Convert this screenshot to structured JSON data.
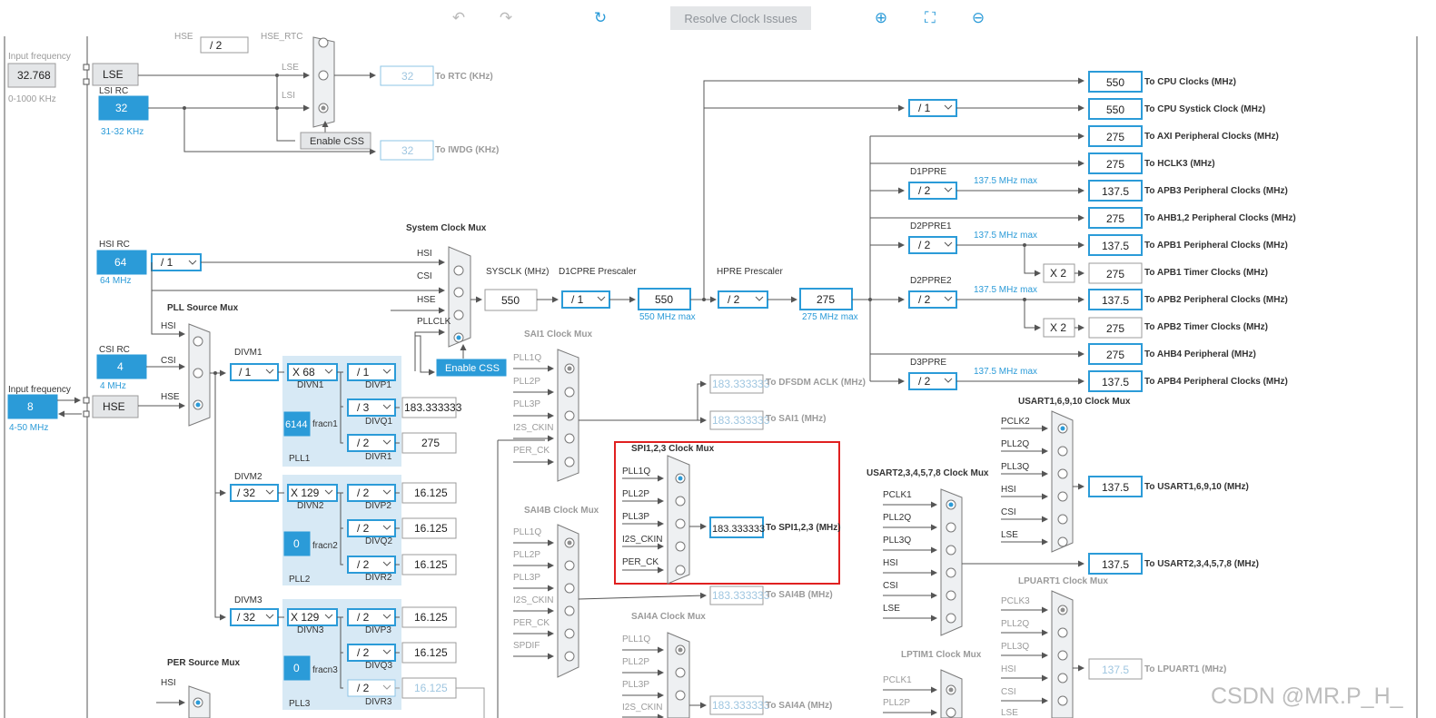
{
  "toolbar": {
    "undo_icon": "undo-icon",
    "redo_icon": "redo-icon",
    "refresh_icon": "refresh-icon",
    "resolve_label": "Resolve Clock Issues",
    "zoom_in_icon": "zoom-in-icon",
    "fit_icon": "fit-screen-icon",
    "zoom_out_icon": "zoom-out-icon"
  },
  "left": {
    "input_freq_label": "Input frequency",
    "lse_input": "32.768",
    "lse_range": "0-1000 KHz",
    "lse_label": "LSE",
    "lsi_rc_label": "LSI RC",
    "lsi_value": "32",
    "lsi_range": "31-32 KHz",
    "hsi_rc_label": "HSI RC",
    "hsi_value": "64",
    "hsi_range": "64 MHz",
    "csi_rc_label": "CSI RC",
    "csi_value": "4",
    "csi_range": "4 MHz",
    "hse_input_label": "Input frequency",
    "hse_input": "8",
    "hse_range": "4-50 MHz",
    "hse_label": "HSE",
    "hse_div2": "/ 2",
    "hse_rtc": "HSE_RTC",
    "hse_top": "HSE",
    "hsi_div": "/ 1",
    "per_src_mux": "PER Source Mux",
    "per_hsi": "HSI"
  },
  "rtc": {
    "lse": "LSE",
    "lsi": "LSI",
    "enable_css": "Enable CSS",
    "rtc_value": "32",
    "rtc_label": "To RTC (KHz)",
    "iwdg_value": "32",
    "iwdg_label": "To IWDG (KHz)"
  },
  "sysmux": {
    "title": "System Clock Mux",
    "hsi": "HSI",
    "csi": "CSI",
    "hse": "HSE",
    "pllclk": "PLLCLK",
    "enable_css": "Enable CSS",
    "sysclk_label": "SYSCLK (MHz)",
    "sysclk": "550",
    "d1cpre_label": "D1CPRE Prescaler",
    "d1cpre": "/ 1",
    "d1_value": "550",
    "d1_max": "550 MHz max",
    "hpre_label": "HPRE Prescaler",
    "hpre": "/ 2",
    "hpre_value": "275",
    "hpre_max": "275 MHz max"
  },
  "pll_src": {
    "title": "PLL Source Mux",
    "hsi": "HSI",
    "csi": "CSI",
    "hse": "HSE"
  },
  "pll1": {
    "divm_label": "DIVM1",
    "divm": "/ 1",
    "divn": "X 68",
    "divn_label": "DIVN1",
    "divp": "/ 1",
    "divp_label": "DIVP1",
    "divq": "/ 3",
    "divq_label": "DIVQ1",
    "q_out": "183.333333",
    "frac": "6144",
    "frac_label": "fracn1",
    "divr": "/ 2",
    "divr_label": "DIVR1",
    "r_out": "275",
    "name": "PLL1"
  },
  "pll2": {
    "divm_label": "DIVM2",
    "divm": "/ 32",
    "divn": "X 129",
    "divn_label": "DIVN2",
    "divp": "/ 2",
    "divp_label": "DIVP2",
    "p_out": "16.125",
    "divq": "/ 2",
    "divq_label": "DIVQ2",
    "q_out": "16.125",
    "frac": "0",
    "frac_label": "fracn2",
    "divr": "/ 2",
    "divr_label": "DIVR2",
    "r_out": "16.125",
    "name": "PLL2"
  },
  "pll3": {
    "divm_label": "DIVM3",
    "divm": "/ 32",
    "divn": "X 129",
    "divn_label": "DIVN3",
    "divp": "/ 2",
    "divp_label": "DIVP3",
    "p_out": "16.125",
    "divq": "/ 2",
    "divq_label": "DIVQ3",
    "q_out": "16.125",
    "frac": "0",
    "frac_label": "fracn3",
    "divr": "/ 2",
    "divr_label": "DIVR3",
    "r_out": "16.125",
    "name": "PLL3"
  },
  "sai1": {
    "title": "SAI1 Clock Mux",
    "in": [
      "PLL1Q",
      "PLL2P",
      "PLL3P",
      "I2S_CKIN",
      "PER_CK"
    ],
    "dfsdm_value": "183.333333",
    "dfsdm_label": "To DFSDM ACLK (MHz)",
    "sai1_value": "183.333333",
    "sai1_label": "To SAI1 (MHz)"
  },
  "sai4b": {
    "title": "SAI4B Clock Mux",
    "in": [
      "PLL1Q",
      "PLL2P",
      "PLL3P",
      "I2S_CKIN",
      "PER_CK",
      "SPDIF"
    ],
    "value": "183.333333",
    "label": "To SAI4B (MHz)"
  },
  "sai4a": {
    "title": "SAI4A Clock Mux",
    "in": [
      "PLL1Q",
      "PLL2P",
      "PLL3P",
      "I2S_CKIN"
    ],
    "value": "183.333333",
    "label": "To SAI4A (MHz)"
  },
  "spi": {
    "title": "SPI1,2,3 Clock Mux",
    "in": [
      "PLL1Q",
      "PLL2P",
      "PLL3P",
      "I2S_CKIN",
      "PER_CK"
    ],
    "value": "183.333333",
    "label": "To SPI1,2,3 (MHz)"
  },
  "usart16": {
    "title": "USART1,6,9,10 Clock Mux",
    "in": [
      "PCLK2",
      "PLL2Q",
      "PLL3Q",
      "HSI",
      "CSI",
      "LSE"
    ],
    "value": "137.5",
    "label": "To USART1,6,9,10 (MHz)"
  },
  "usart2": {
    "title": "USART2,3,4,5,7,8 Clock Mux",
    "in": [
      "PCLK1",
      "PLL2Q",
      "PLL3Q",
      "HSI",
      "CSI",
      "LSE"
    ],
    "value": "137.5",
    "label": "To USART2,3,4,5,7,8 (MHz)"
  },
  "lpuart": {
    "title": "LPUART1 Clock Mux",
    "in": [
      "PCLK3",
      "PLL2Q",
      "PLL3Q",
      "HSI",
      "CSI",
      "LSE"
    ],
    "value": "137.5",
    "label": "To LPUART1 (MHz)"
  },
  "lptim": {
    "title": "LPTIM1 Clock Mux",
    "in": [
      "PCLK1",
      "PLL2P"
    ]
  },
  "outputs": {
    "cpu_value": "550",
    "cpu_label": "To CPU Clocks (MHz)",
    "systick_div": "/ 1",
    "systick_value": "550",
    "systick_label": "To CPU Systick Clock (MHz)",
    "axi_value": "275",
    "axi_label": "To AXI Peripheral Clocks (MHz)",
    "hclk3_value": "275",
    "hclk3_label": "To HCLK3 (MHz)",
    "d1ppre_label": "D1PPRE",
    "d1ppre": "/ 2",
    "d1ppre_max": "137.5 MHz max",
    "apb3_value": "137.5",
    "apb3_label": "To APB3 Peripheral Clocks (MHz)",
    "ahb12_value": "275",
    "ahb12_label": "To AHB1,2 Peripheral Clocks (MHz)",
    "d2ppre1_label": "D2PPRE1",
    "d2ppre1": "/ 2",
    "d2ppre1_max": "137.5 MHz max",
    "apb1_value": "137.5",
    "apb1_label": "To APB1 Peripheral Clocks (MHz)",
    "x2_1": "X 2",
    "apb1t_value": "275",
    "apb1t_label": "To APB1 Timer Clocks (MHz)",
    "d2ppre2_label": "D2PPRE2",
    "d2ppre2": "/ 2",
    "d2ppre2_max": "137.5 MHz max",
    "apb2_value": "137.5",
    "apb2_label": "To APB2 Peripheral Clocks (MHz)",
    "x2_2": "X 2",
    "apb2t_value": "275",
    "apb2t_label": "To APB2 Timer Clocks (MHz)",
    "ahb4_value": "275",
    "ahb4_label": "To AHB4 Peripheral (MHz)",
    "d3ppre_label": "D3PPRE",
    "d3ppre": "/ 2",
    "d3ppre_max": "137.5 MHz max",
    "apb4_value": "137.5",
    "apb4_label": "To APB4 Peripheral Clocks (MHz)"
  },
  "watermark": "CSDN @MR.P_H_",
  "colors": {
    "accent": "#2b9bd8",
    "highlight": "#e02020"
  }
}
